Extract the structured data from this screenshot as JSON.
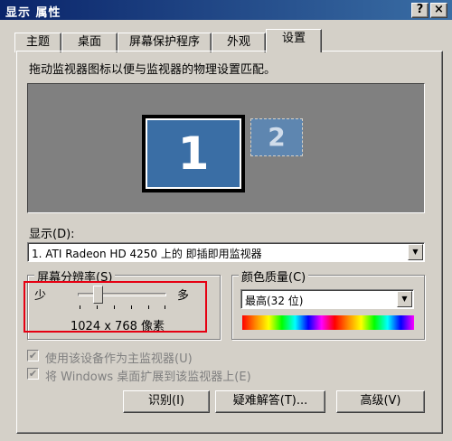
{
  "window": {
    "title": "显示 属性",
    "help_label": "?",
    "close_label": "×"
  },
  "tabs": [
    {
      "label": "主题"
    },
    {
      "label": "桌面"
    },
    {
      "label": "屏幕保护程序"
    },
    {
      "label": "外观"
    },
    {
      "label": "设置"
    }
  ],
  "settings": {
    "instruction": "拖动监视器图标以便与监视器的物理设置匹配。",
    "monitors": [
      {
        "number": "1"
      },
      {
        "number": "2"
      }
    ],
    "display_label": "显示(D):",
    "display_value": "1. ATI Radeon HD 4250 上的 即插即用监视器",
    "resolution": {
      "title": "屏幕分辨率(S)",
      "less_label": "少",
      "more_label": "多",
      "value_text": "1024 x 768 像素",
      "slider_position": 0.2
    },
    "color_quality": {
      "title": "颜色质量(C)",
      "selected": "最高(32 位)"
    },
    "checkboxes": [
      {
        "label": "使用该设备作为主监视器(U)",
        "checked": true,
        "enabled": false
      },
      {
        "label": "将 Windows 桌面扩展到该监视器上(E)",
        "checked": true,
        "enabled": false
      }
    ],
    "buttons": {
      "identify": "识别(I)",
      "troubleshoot": "疑难解答(T)...",
      "advanced": "高级(V)"
    }
  },
  "colors": {
    "highlight_box": "#e60012",
    "title_bar": "#0a246a",
    "monitor_blue": "#3a6ea5"
  }
}
